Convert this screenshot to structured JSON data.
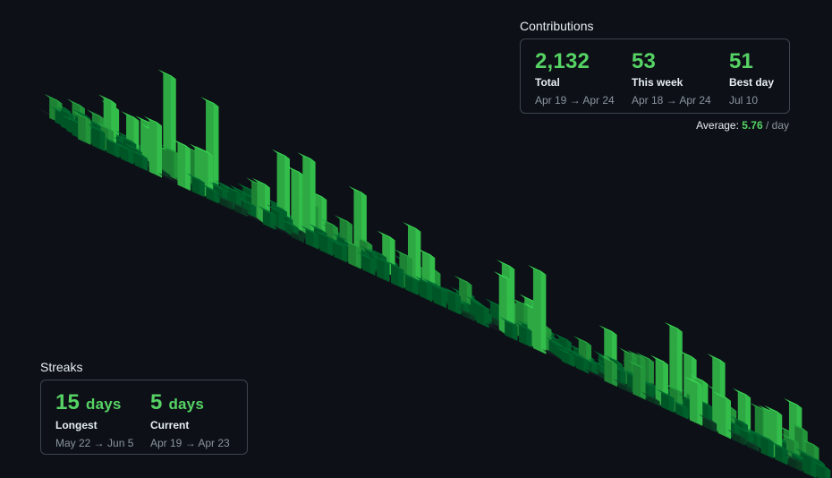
{
  "contributions": {
    "title": "Contributions",
    "stats": [
      {
        "value": "2,132",
        "label": "Total",
        "range": "Apr 19 → Apr 24"
      },
      {
        "value": "53",
        "label": "This week",
        "range": "Apr 18 → Apr 24"
      },
      {
        "value": "51",
        "label": "Best day",
        "range": "Jul 10"
      }
    ],
    "average": {
      "label": "Average:",
      "value": "5.76",
      "unit": "/ day"
    }
  },
  "streaks": {
    "title": "Streaks",
    "longest": {
      "number": "15",
      "unit": "days",
      "label": "Longest",
      "range": "May 22 → Jun 5"
    },
    "current": {
      "number": "5",
      "unit": "days",
      "label": "Current",
      "range": "Apr 19 → Apr 23"
    }
  },
  "calendar": {
    "weeks": 53,
    "days_per_week": 7,
    "colors": {
      "empty": "#161b22",
      "level1": "#0e4429",
      "level2": "#006d32",
      "level3": "#26a641",
      "level4": "#39d353"
    }
  }
}
